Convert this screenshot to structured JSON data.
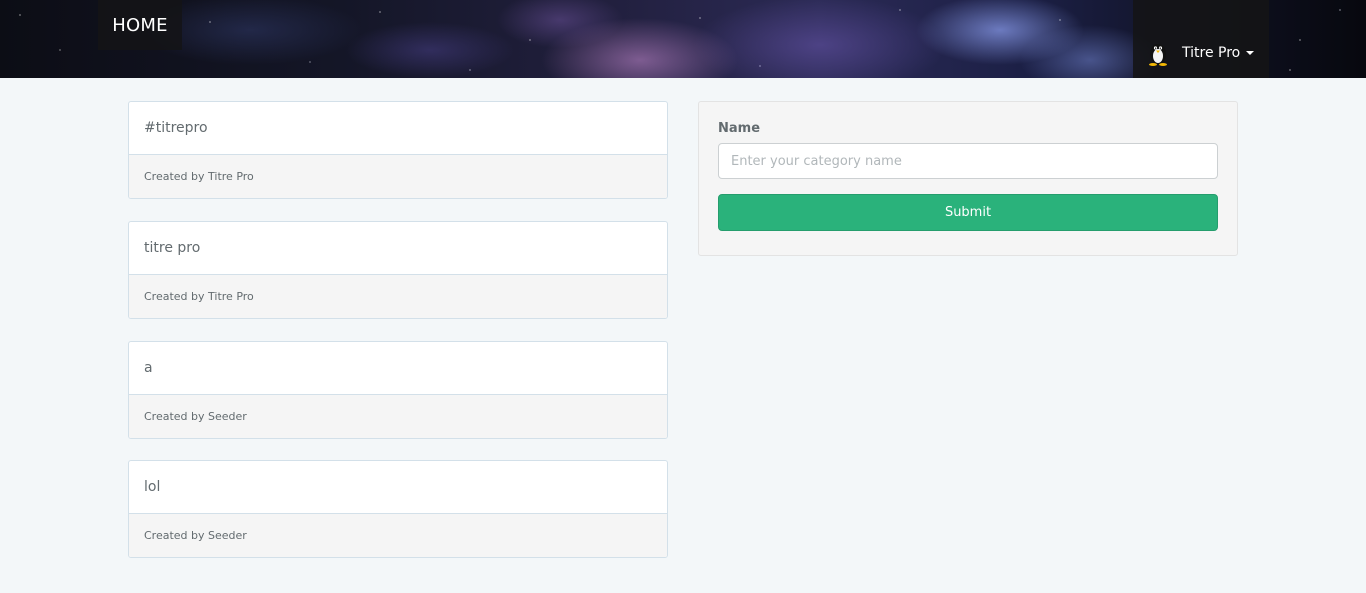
{
  "navbar": {
    "home_label": "HOME",
    "user": {
      "name": "Titre Pro",
      "avatar_icon": "penguin-icon"
    }
  },
  "categories": [
    {
      "title": "#titrepro",
      "footer": "Created by Titre Pro"
    },
    {
      "title": "titre pro",
      "footer": "Created by Titre Pro"
    },
    {
      "title": "a",
      "footer": "Created by Seeder"
    },
    {
      "title": "lol",
      "footer": "Created by Seeder"
    }
  ],
  "form": {
    "name_label": "Name",
    "name_value": "",
    "name_placeholder": "Enter your category name",
    "submit_label": "Submit"
  },
  "colors": {
    "background": "#f3f7f9",
    "submit": "#2ab27b",
    "navbar_dark": "#141416"
  }
}
